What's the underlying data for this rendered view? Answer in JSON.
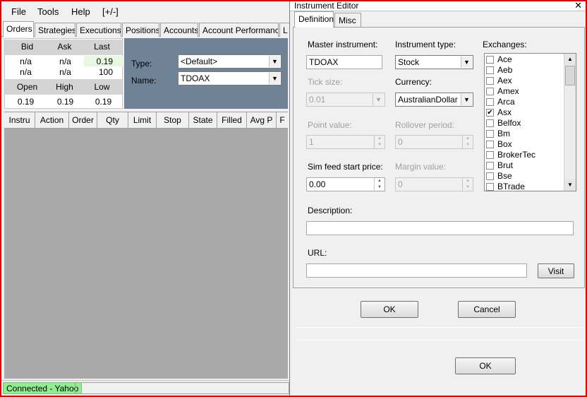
{
  "menu": [
    "File",
    "Tools",
    "Help",
    "[+/-]"
  ],
  "main_tabs": [
    "Orders",
    "Strategies",
    "Executions",
    "Positions",
    "Accounts",
    "Account Performance",
    "L"
  ],
  "quote": {
    "headers1": [
      "Bid",
      "Ask",
      "Last"
    ],
    "row1": [
      "n/a",
      "n/a",
      "0.19"
    ],
    "row2": [
      "n/a",
      "n/a",
      "100"
    ],
    "headers2": [
      "Open",
      "High",
      "Low"
    ],
    "row3": [
      "0.19",
      "0.19",
      "0.19"
    ]
  },
  "selector": {
    "type_label": "Type:",
    "type_value": "<Default>",
    "name_label": "Name:",
    "name_value": "TDOAX"
  },
  "grid_columns": [
    "Instru",
    "Action",
    "Order",
    "Qty",
    "Limit",
    "Stop",
    "State",
    "Filled",
    "Avg P",
    "F"
  ],
  "status": {
    "connection": "Connected - Yahoo"
  },
  "dialog": {
    "title": "Instrument Editor",
    "close": "✕",
    "tabs": [
      "Definition",
      "Misc"
    ],
    "master_label": "Master instrument:",
    "master_value": "TDOAX",
    "type_label": "Instrument type:",
    "type_value": "Stock",
    "exchanges_label": "Exchanges:",
    "tick_label": "Tick size:",
    "tick_value": "0.01",
    "currency_label": "Currency:",
    "currency_value": "AustralianDollar",
    "point_label": "Point value:",
    "point_value": "1",
    "rollover_label": "Rollover period:",
    "rollover_value": "0",
    "simfeed_label": "Sim feed start price:",
    "simfeed_value": "0.00",
    "margin_label": "Margin value:",
    "margin_value": "0",
    "description_label": "Description:",
    "description_value": "",
    "url_label": "URL:",
    "url_value": "",
    "visit_label": "Visit",
    "ok_label": "OK",
    "cancel_label": "Cancel",
    "outer_ok_label": "OK",
    "exchanges": [
      {
        "name": "Ace",
        "checked": false
      },
      {
        "name": "Aeb",
        "checked": false
      },
      {
        "name": "Aex",
        "checked": false
      },
      {
        "name": "Amex",
        "checked": false
      },
      {
        "name": "Arca",
        "checked": false
      },
      {
        "name": "Asx",
        "checked": true
      },
      {
        "name": "Belfox",
        "checked": false
      },
      {
        "name": "Bm",
        "checked": false
      },
      {
        "name": "Box",
        "checked": false
      },
      {
        "name": "BrokerTec",
        "checked": false
      },
      {
        "name": "Brut",
        "checked": false
      },
      {
        "name": "Bse",
        "checked": false
      },
      {
        "name": "BTrade",
        "checked": false
      }
    ]
  },
  "colors": {
    "status_green": "#90ee90",
    "blue_panel": "#6f8296",
    "grid_gray": "#a9a9a9",
    "frame_red": "#e00000"
  }
}
